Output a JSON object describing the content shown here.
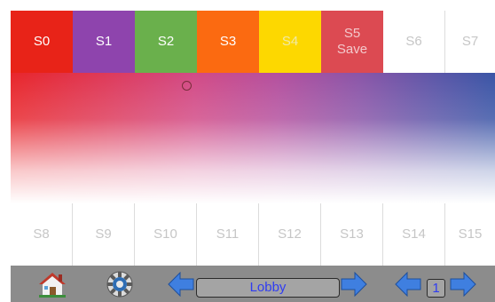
{
  "scenes_top": [
    {
      "label": "S0",
      "sub": "",
      "color": "#e82318"
    },
    {
      "label": "S1",
      "sub": "",
      "color": "#8e44ad"
    },
    {
      "label": "S2",
      "sub": "",
      "color": "#6ab04c"
    },
    {
      "label": "S3",
      "sub": "",
      "color": "#fb6a11"
    },
    {
      "label": "S4",
      "sub": "",
      "color": "#fdd800"
    },
    {
      "label": "S5",
      "sub": "Save",
      "color": "#dc4a52"
    },
    {
      "label": "S6",
      "sub": "",
      "color": ""
    },
    {
      "label": "S7",
      "sub": "",
      "color": ""
    }
  ],
  "scenes_bottom": [
    {
      "label": "S8"
    },
    {
      "label": "S9"
    },
    {
      "label": "S10"
    },
    {
      "label": "S11"
    },
    {
      "label": "S12"
    },
    {
      "label": "S13"
    },
    {
      "label": "S14"
    },
    {
      "label": "S15"
    }
  ],
  "toolbar": {
    "room_name": "Lobby",
    "sub_page": "1",
    "icons": [
      "home-icon",
      "gear-icon",
      "arrow-left-icon",
      "arrow-right-icon"
    ]
  },
  "colors": {
    "toolbar_bg": "#8c8c8c",
    "arrow_blue": "#3f7fe0",
    "room_text": "#2f3cf2"
  }
}
